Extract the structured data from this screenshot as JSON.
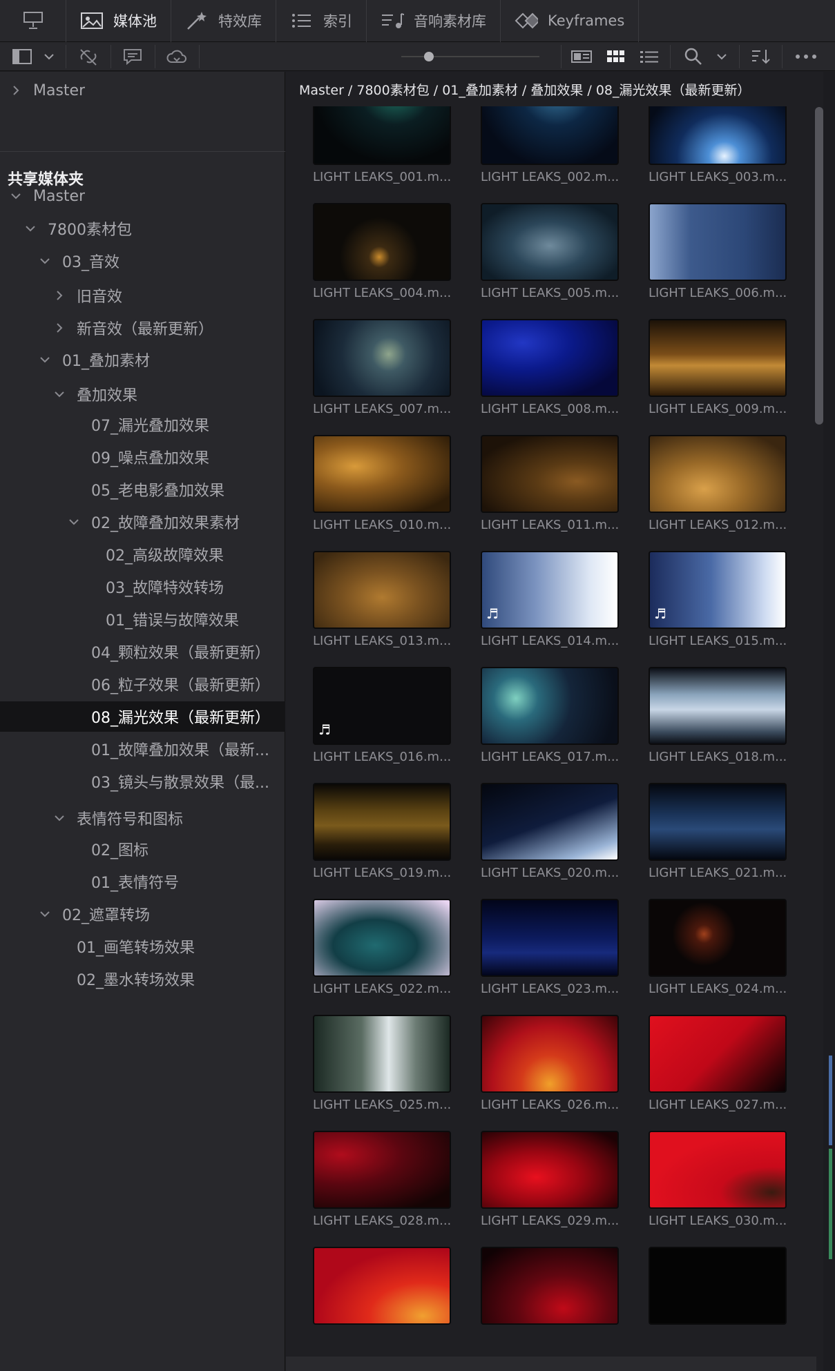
{
  "topbar": {
    "tabs": [
      {
        "label": "媒体池",
        "icon": "media-pool-icon",
        "active": true
      },
      {
        "label": "特效库",
        "icon": "effects-wand-icon",
        "active": false
      },
      {
        "label": "索引",
        "icon": "index-list-icon",
        "active": false
      },
      {
        "label": "音响素材库",
        "icon": "sound-library-icon",
        "active": false
      },
      {
        "label": "Keyframes",
        "icon": "keyframes-icon",
        "active": false
      }
    ]
  },
  "toolbar": {
    "zoom_level": 0.2
  },
  "sidebar": {
    "master_top": "Master",
    "shared_title": "共享媒体夹",
    "tree": [
      {
        "label": "Master",
        "chev": "down",
        "depth": 0
      },
      {
        "label": "7800素材包",
        "chev": "down",
        "depth": 1
      },
      {
        "label": "03_音效",
        "chev": "down",
        "depth": 2
      },
      {
        "label": "旧音效",
        "chev": "right",
        "depth": 3
      },
      {
        "label": "新音效（最新更新）",
        "chev": "right",
        "depth": 3
      },
      {
        "label": "01_叠加素材",
        "chev": "down",
        "depth": 2
      },
      {
        "label": "叠加效果",
        "chev": "down",
        "depth": 3
      },
      {
        "label": "07_漏光叠加效果",
        "chev": "",
        "depth": 4
      },
      {
        "label": "09_噪点叠加效果",
        "chev": "",
        "depth": 4
      },
      {
        "label": "05_老电影叠加效果",
        "chev": "",
        "depth": 4
      },
      {
        "label": "02_故障叠加效果素材",
        "chev": "down",
        "depth": 4
      },
      {
        "label": "02_高级故障效果",
        "chev": "",
        "depth": 5
      },
      {
        "label": "03_故障特效转场",
        "chev": "",
        "depth": 5
      },
      {
        "label": "01_错误与故障效果",
        "chev": "",
        "depth": 5
      },
      {
        "label": "04_颗粒效果（最新更新）",
        "chev": "",
        "depth": 4
      },
      {
        "label": "06_粒子效果（最新更新）",
        "chev": "",
        "depth": 4
      },
      {
        "label": "08_漏光效果（最新更新）",
        "chev": "",
        "depth": 4,
        "selected": true
      },
      {
        "label": "01_故障叠加效果（最新...",
        "chev": "",
        "depth": 4
      },
      {
        "label": "03_镜头与散景效果（最...",
        "chev": "",
        "depth": 4
      },
      {
        "label": "表情符号和图标",
        "chev": "down",
        "depth": 3
      },
      {
        "label": "02_图标",
        "chev": "",
        "depth": 4
      },
      {
        "label": "01_表情符号",
        "chev": "",
        "depth": 4
      },
      {
        "label": "02_遮罩转场",
        "chev": "down",
        "depth": 2
      },
      {
        "label": "01_画笔转场效果",
        "chev": "",
        "depth": 3
      },
      {
        "label": "02_墨水转场效果",
        "chev": "",
        "depth": 3
      }
    ]
  },
  "main": {
    "breadcrumb": "Master / 7800素材包 / 01_叠加素材 / 叠加效果 / 08_漏光效果（最新更新）",
    "clips": [
      {
        "name": "LIGHT LEAKS_001.m...",
        "bg": "radial-gradient(ellipse at 60% 10%, #1d6b5e 0%, #0b1e22 30%, #05080a 70%)",
        "audio": false
      },
      {
        "name": "LIGHT LEAKS_002.m...",
        "bg": "radial-gradient(ellipse at 55% 0%, #3c7ea6 0%, #0d2744 35%, #050b18 75%)",
        "audio": false
      },
      {
        "name": "LIGHT LEAKS_003.m...",
        "bg": "radial-gradient(ellipse at 55% 90%, #e6f2ff 0%, #4d8fd6 15%, #102c5c 45%, #050b18 80%)",
        "audio": false
      },
      {
        "name": "LIGHT LEAKS_004.m...",
        "bg": "radial-gradient(circle at 48% 70%, #c98a2c 0%, #3c2a12 12%, #0d0b08 45%)",
        "audio": false
      },
      {
        "name": "LIGHT LEAKS_005.m...",
        "bg": "radial-gradient(ellipse at 50% 55%, #6f8a9c 0%, #2b4659 40%, #0f1d28 80%)",
        "audio": false
      },
      {
        "name": "LIGHT LEAKS_006.m...",
        "bg": "linear-gradient(90deg, #8ba4cc 0%, #3d5a8c 30%, #2c4777 70%, #1b2d52 100%)",
        "audio": false
      },
      {
        "name": "LIGHT LEAKS_007.m...",
        "bg": "radial-gradient(circle at 55% 45%, #8fa58c 0%, #3f5a64 20%, #1b2b3a 55%, #0c1520 90%)",
        "audio": false
      },
      {
        "name": "LIGHT LEAKS_008.m...",
        "bg": "radial-gradient(ellipse at 30% 30%, #2237c4 0%, #0b1a8c 35%, #05083a 80%)",
        "audio": false
      },
      {
        "name": "LIGHT LEAKS_009.m...",
        "bg": "linear-gradient(180deg, #1c1208 0%, #7a4d18 45%, #c28a36 60%, #2c1a08 100%)",
        "audio": false
      },
      {
        "name": "LIGHT LEAKS_010.m...",
        "bg": "radial-gradient(ellipse at 30% 40%, #d89a3a 0%, #8c5a1c 35%, #2d1c08 85%)",
        "audio": false
      },
      {
        "name": "LIGHT LEAKS_011.m...",
        "bg": "radial-gradient(ellipse at 70% 60%, #8a5a22 0%, #5a3a14 30%, #1d1208 80%)",
        "audio": false
      },
      {
        "name": "LIGHT LEAKS_012.m...",
        "bg": "radial-gradient(ellipse at 40% 70%, #d9a04a 0%, #9a6a28 35%, #3a2610 85%)",
        "audio": false
      },
      {
        "name": "LIGHT LEAKS_013.m...",
        "bg": "radial-gradient(ellipse at 50% 60%, #b07a30 0%, #7a5220 40%, #3c2810 90%)",
        "audio": false
      },
      {
        "name": "LIGHT LEAKS_014.m...",
        "bg": "linear-gradient(90deg, #304a7c 0%, #7c94c0 40%, #dfe8f5 80%, #ffffff 100%)",
        "audio": true
      },
      {
        "name": "LIGHT LEAKS_015.m...",
        "bg": "linear-gradient(90deg, #1c2c5c 0%, #4a6aa6 45%, #cfdcf2 85%, #ffffff 100%)",
        "audio": true
      },
      {
        "name": "LIGHT LEAKS_016.m...",
        "bg": "#0c0c0e",
        "audio": true
      },
      {
        "name": "LIGHT LEAKS_017.m...",
        "bg": "radial-gradient(circle at 25% 40%, #7fd0c0 0%, #2a6a7c 20%, #14253a 50%, #0a0f1a 90%)",
        "audio": false
      },
      {
        "name": "LIGHT LEAKS_018.m...",
        "bg": "linear-gradient(180deg, #0c0f16 0%, #8aa4bc 35%, #c8d6e6 55%, #3a4a5c 85%, #0c0f16 100%)",
        "audio": false
      },
      {
        "name": "LIGHT LEAKS_019.m...",
        "bg": "linear-gradient(180deg, #0a0806 0%, #5a4212 35%, #7a5a1c 55%, #2a1e0a 80%, #0a0806 100%)",
        "audio": false
      },
      {
        "name": "LIGHT LEAKS_020.m...",
        "bg": "linear-gradient(160deg, #04070f 0%, #0f1c3c 50%, #9ab4d6 85%, #ffffff 100%)",
        "audio": false
      },
      {
        "name": "LIGHT LEAKS_021.m...",
        "bg": "linear-gradient(180deg, #04070f 0%, #1a3358 40%, #2a4a78 60%, #04070f 100%)",
        "audio": false
      },
      {
        "name": "LIGHT LEAKS_022.m...",
        "bg": "radial-gradient(ellipse at 45% 60%, #206a70 0%, #123e46 40%, #e8d4f0 95%)",
        "audio": false
      },
      {
        "name": "LIGHT LEAKS_023.m...",
        "bg": "linear-gradient(180deg, #02051a 0%, #0c1a5c 50%, #172a7c 70%, #02051a 100%)",
        "audio": false
      },
      {
        "name": "LIGHT LEAKS_024.m...",
        "bg": "radial-gradient(circle at 40% 45%, #a0401c 0%, #4a180c 10%, #0a0606 35%)",
        "audio": false
      },
      {
        "name": "LIGHT LEAKS_025.m...",
        "bg": "linear-gradient(90deg, #1c2a24 0%, #5a6c62 35%, #dfe6e8 55%, #6c7c74 75%, #1c2a24 100%)",
        "audio": false
      },
      {
        "name": "LIGHT LEAKS_026.m...",
        "bg": "radial-gradient(ellipse at 50% 90%, #f0a02a 0%, #d43a1a 30%, #b0101a 60%, #3c0408 100%)",
        "audio": false
      },
      {
        "name": "LIGHT LEAKS_027.m...",
        "bg": "linear-gradient(135deg, #e0101e 0%, #c00818 50%, #3c0408 85%, #0a0204 100%)",
        "audio": false
      },
      {
        "name": "LIGHT LEAKS_028.m...",
        "bg": "radial-gradient(ellipse at 20% 30%, #b00c1c 0%, #5a0610 40%, #140404 85%)",
        "audio": false
      },
      {
        "name": "LIGHT LEAKS_029.m...",
        "bg": "radial-gradient(ellipse at 40% 60%, #e8101e 0%, #9a0612 40%, #1c0204 90%)",
        "audio": false
      },
      {
        "name": "LIGHT LEAKS_030.m...",
        "bg": "radial-gradient(ellipse at 90% 80%, #3a1a10 0%, #c80a1a 30%, #e0101e 70%)",
        "audio": false
      },
      {
        "name": "",
        "bg": "radial-gradient(ellipse at 80% 90%, #f0a030 0%, #e02a1a 35%, #b0081a 70%)",
        "audio": false
      },
      {
        "name": "",
        "bg": "radial-gradient(ellipse at 60% 80%, #c00a18 0%, #600610 40%, #100204 90%)",
        "audio": false
      },
      {
        "name": "",
        "bg": "#040404",
        "audio": false
      }
    ]
  },
  "colors": {
    "panel": "#28282c",
    "background": "#1f1f23",
    "selected_row": "#141416",
    "text": "#b9b9bd"
  }
}
